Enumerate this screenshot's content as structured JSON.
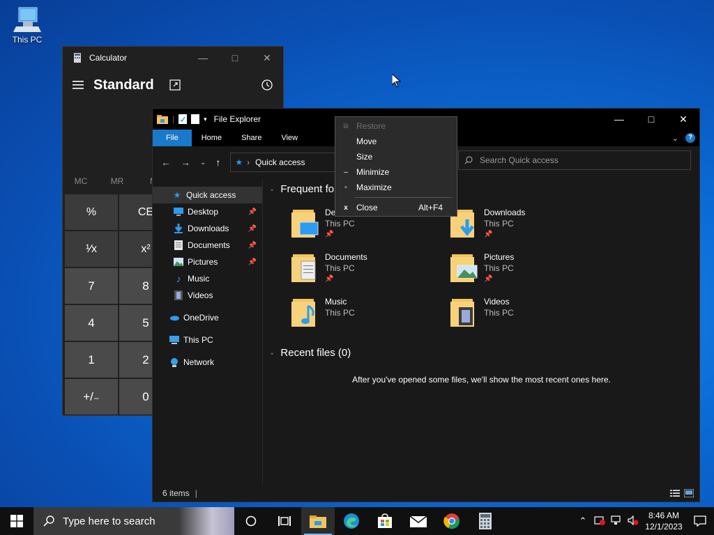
{
  "desktop": {
    "icons": [
      {
        "label": "This PC",
        "icon": "this-pc-icon"
      }
    ]
  },
  "calculator": {
    "title": "Calculator",
    "mode": "Standard",
    "memory": [
      "MC",
      "MR",
      "M"
    ],
    "keys": [
      {
        "label": "%",
        "type": "op"
      },
      {
        "label": "CE",
        "type": "op"
      },
      {
        "label": "¹⁄x",
        "type": "op"
      },
      {
        "label": "x²",
        "type": "op"
      },
      {
        "label": "7",
        "type": "num"
      },
      {
        "label": "8",
        "type": "num"
      },
      {
        "label": "4",
        "type": "num"
      },
      {
        "label": "5",
        "type": "num"
      },
      {
        "label": "1",
        "type": "num"
      },
      {
        "label": "2",
        "type": "num"
      },
      {
        "label": "+/₋",
        "type": "num"
      },
      {
        "label": "0",
        "type": "num"
      }
    ]
  },
  "explorer": {
    "title": "File Explorer",
    "ribbon_tabs": [
      "File",
      "Home",
      "Share",
      "View"
    ],
    "address": "Quick access",
    "search_placeholder": "Search Quick access",
    "nav": [
      {
        "label": "Quick access",
        "icon": "star-icon",
        "pinned": false,
        "selected": true,
        "indent": 0
      },
      {
        "label": "Desktop",
        "icon": "desktop-icon",
        "pinned": true,
        "indent": 1
      },
      {
        "label": "Downloads",
        "icon": "downloads-icon",
        "pinned": true,
        "indent": 1
      },
      {
        "label": "Documents",
        "icon": "documents-icon",
        "pinned": true,
        "indent": 1
      },
      {
        "label": "Pictures",
        "icon": "pictures-icon",
        "pinned": true,
        "indent": 1
      },
      {
        "label": "Music",
        "icon": "music-icon",
        "pinned": false,
        "indent": 1
      },
      {
        "label": "Videos",
        "icon": "videos-icon",
        "pinned": false,
        "indent": 1
      },
      {
        "label": "OneDrive",
        "icon": "onedrive-icon",
        "pinned": false,
        "indent": 0
      },
      {
        "label": "This PC",
        "icon": "this-pc-icon",
        "pinned": false,
        "indent": 0
      },
      {
        "label": "Network",
        "icon": "network-icon",
        "pinned": false,
        "indent": 0
      }
    ],
    "frequent_header": "Frequent fol",
    "frequent": [
      {
        "name": "De",
        "location": "This PC",
        "pinned": true,
        "icon": "desktop-folder-icon"
      },
      {
        "name": "Downloads",
        "location": "This PC",
        "pinned": true,
        "icon": "downloads-folder-icon"
      },
      {
        "name": "Documents",
        "location": "This PC",
        "pinned": true,
        "icon": "documents-folder-icon"
      },
      {
        "name": "Pictures",
        "location": "This PC",
        "pinned": true,
        "icon": "pictures-folder-icon"
      },
      {
        "name": "Music",
        "location": "This PC",
        "pinned": false,
        "icon": "music-folder-icon"
      },
      {
        "name": "Videos",
        "location": "This PC",
        "pinned": false,
        "icon": "videos-folder-icon"
      }
    ],
    "recent_header": "Recent files (0)",
    "recent_empty": "After you've opened some files, we'll show the most recent ones here.",
    "status": "6 items"
  },
  "context_menu": {
    "items": [
      {
        "label": "Restore",
        "glyph": "⧉",
        "disabled": true,
        "accel": ""
      },
      {
        "label": "Move",
        "glyph": "",
        "disabled": false,
        "accel": ""
      },
      {
        "label": "Size",
        "glyph": "",
        "disabled": false,
        "accel": ""
      },
      {
        "label": "Minimize",
        "glyph": "‒",
        "disabled": false,
        "accel": ""
      },
      {
        "label": "Maximize",
        "glyph": "▫",
        "disabled": false,
        "accel": ""
      },
      {
        "label": "Close",
        "glyph": "x",
        "disabled": false,
        "accel": "Alt+F4"
      }
    ]
  },
  "taskbar": {
    "search_placeholder": "Type here to search",
    "time": "8:46 AM",
    "date": "12/1/2023"
  },
  "colors": {
    "accent": "#1979ca",
    "folder": "#f2c55c"
  }
}
